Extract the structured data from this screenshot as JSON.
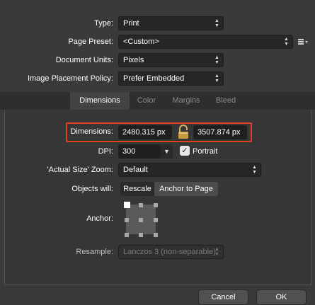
{
  "document": {
    "type_label": "Type:",
    "type_value": "Print",
    "preset_label": "Page Preset:",
    "preset_value": "<Custom>",
    "units_label": "Document Units:",
    "units_value": "Pixels",
    "placement_label": "Image Placement Policy:",
    "placement_value": "Prefer Embedded"
  },
  "tabs": [
    "Dimensions",
    "Color",
    "Margins",
    "Bleed"
  ],
  "dimensions": {
    "label": "Dimensions:",
    "width": "2480.315 px",
    "height": "3507.874 px",
    "highlight_color": "#e0402a"
  },
  "dpi": {
    "label": "DPI:",
    "value": "300",
    "portrait_label": "Portrait",
    "portrait_checked": true
  },
  "zoom": {
    "label": "'Actual Size' Zoom:",
    "value": "Default"
  },
  "objects": {
    "label": "Objects will:",
    "options": [
      "Rescale",
      "Anchor to Page"
    ],
    "selected": "Anchor to Page"
  },
  "anchor": {
    "label": "Anchor:"
  },
  "resample": {
    "label": "Resample:",
    "value": "Lanczos 3 (non-separable)"
  },
  "buttons": {
    "cancel": "Cancel",
    "ok": "OK"
  }
}
